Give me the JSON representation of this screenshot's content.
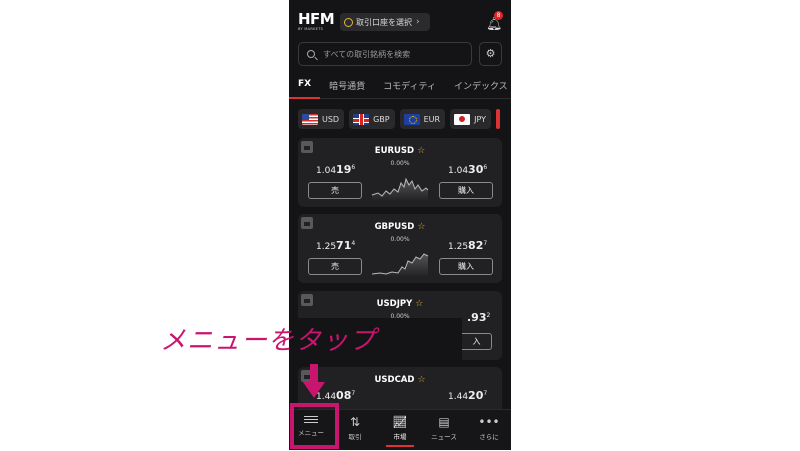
{
  "header": {
    "logo_text": "HFM",
    "logo_sub": "BY MARKETS",
    "account_button": "取引口座を選択",
    "notification_count": "8"
  },
  "search": {
    "placeholder": "すべての取引銘柄を検索"
  },
  "tabs": [
    {
      "label": "FX",
      "active": true
    },
    {
      "label": "暗号通貨"
    },
    {
      "label": "コモディティ"
    },
    {
      "label": "インデックス"
    }
  ],
  "currencies": [
    "USD",
    "GBP",
    "EUR",
    "JPY"
  ],
  "instruments": [
    {
      "symbol": "EURUSD",
      "change": "0.00%",
      "bid_pre": "1.04",
      "bid_big": "19",
      "bid_sup": "6",
      "ask_pre": "1.04",
      "ask_big": "30",
      "ask_sup": "6",
      "sell": "売",
      "buy": "購入"
    },
    {
      "symbol": "GBPUSD",
      "change": "0.00%",
      "bid_pre": "1.25",
      "bid_big": "71",
      "bid_sup": "4",
      "ask_pre": "1.25",
      "ask_big": "82",
      "ask_sup": "7",
      "sell": "売",
      "buy": "購入"
    },
    {
      "symbol": "USDJPY",
      "change": "0.00%",
      "ask_big": ".93",
      "ask_sup": "2",
      "buy": "入"
    },
    {
      "symbol": "USDCAD",
      "bid_pre": "1.44",
      "bid_big": "08",
      "bid_sup": "7",
      "ask_pre": "1.44",
      "ask_big": "20",
      "ask_sup": "7"
    }
  ],
  "annotation": "メニューをタップ",
  "bottom_nav": [
    {
      "label": "メニュー",
      "icon": "menu-icon"
    },
    {
      "label": "取引",
      "icon": "trade-arrows-icon"
    },
    {
      "label": "市場",
      "icon": "markets-chart-icon",
      "active": true
    },
    {
      "label": "ニュース",
      "icon": "news-icon"
    },
    {
      "label": "さらに",
      "icon": "more-dots-icon"
    }
  ],
  "colors": {
    "accent": "#d33333",
    "annotation": "#c8156e",
    "star": "#e7b530",
    "background": "#141416"
  }
}
